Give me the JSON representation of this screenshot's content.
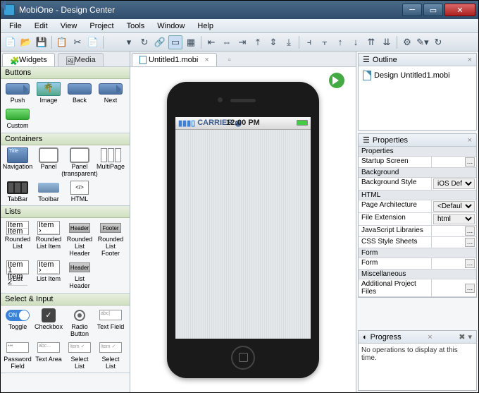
{
  "window": {
    "title": "MobiOne - Design Center"
  },
  "menu": [
    "File",
    "Edit",
    "View",
    "Project",
    "Tools",
    "Window",
    "Help"
  ],
  "left": {
    "tabs": [
      {
        "icon": "puzzle",
        "label": "Widgets",
        "active": true
      },
      {
        "icon": "media",
        "label": "Media",
        "active": false
      }
    ],
    "sections": [
      {
        "title": "Buttons",
        "items": [
          {
            "name": "push",
            "label": "Push",
            "shape": "btn-shape arrow-r"
          },
          {
            "name": "image",
            "label": "Image",
            "shape": "img-shape"
          },
          {
            "name": "back",
            "label": "Back",
            "shape": "btn-shape arrow-l"
          },
          {
            "name": "next",
            "label": "Next",
            "shape": "btn-shape arrow-r"
          },
          {
            "name": "custom",
            "label": "Custom",
            "shape": "grn-btn"
          }
        ]
      },
      {
        "title": "Containers",
        "items": [
          {
            "name": "navigation",
            "label": "Navigation",
            "shape": "nav-shape",
            "txt": "Title"
          },
          {
            "name": "panel",
            "label": "Panel",
            "shape": "panel-shape"
          },
          {
            "name": "panel-transparent",
            "label": "Panel (transparent)",
            "shape": "panel-shape"
          },
          {
            "name": "multipage",
            "label": "MultiPage",
            "shape": "multi-shape"
          },
          {
            "name": "tabbar",
            "label": "TabBar",
            "shape": "tabbar-shape"
          },
          {
            "name": "toolbar",
            "label": "Toolbar",
            "shape": "toolbar-shape"
          },
          {
            "name": "html",
            "label": "HTML",
            "shape": "html-shape",
            "txt": "</>"
          }
        ]
      },
      {
        "title": "Lists",
        "items": [
          {
            "name": "rounded-list",
            "label": "Rounded List",
            "shape": "list-shape",
            "txt": "Item|Item"
          },
          {
            "name": "rounded-list-item",
            "label": "Rounded List Item",
            "shape": "list-shape",
            "txt": "Item  ›"
          },
          {
            "name": "rounded-list-header",
            "label": "Rounded List Header",
            "shape": "hdr-shape",
            "txt": "Header"
          },
          {
            "name": "rounded-list-footer",
            "label": "Rounded List Footer",
            "shape": "hdr-shape",
            "txt": "Footer"
          },
          {
            "name": "list",
            "label": "List",
            "shape": "list-shape",
            "txt": "Item 1|Item 2"
          },
          {
            "name": "list-item",
            "label": "List Item",
            "shape": "list-shape",
            "txt": "Item  ›"
          },
          {
            "name": "list-header",
            "label": "List Header",
            "shape": "hdr-shape",
            "txt": "Header"
          }
        ]
      },
      {
        "title": "Select & Input",
        "items": [
          {
            "name": "toggle",
            "label": "Toggle",
            "shape": "toggle-on",
            "txt": "ON"
          },
          {
            "name": "checkbox",
            "label": "Checkbox",
            "shape": "chk-shape",
            "txt": "✓"
          },
          {
            "name": "radio",
            "label": "Radio Button",
            "shape": "radio-shape"
          },
          {
            "name": "text-field",
            "label": "Text Field",
            "shape": "txt-shape",
            "txt": "abc|"
          },
          {
            "name": "password",
            "label": "Password Field",
            "shape": "txt-shape",
            "txt": "•••"
          },
          {
            "name": "textarea",
            "label": "Text Area",
            "shape": "txt-shape",
            "txt": "abc..."
          },
          {
            "name": "select-list",
            "label": "Select List",
            "shape": "txt-shape",
            "txt": "Item ✓"
          },
          {
            "name": "select-list2",
            "label": "Select List",
            "shape": "txt-shape",
            "txt": "Item ✓"
          }
        ]
      }
    ]
  },
  "center": {
    "tab_label": "Untitled1.mobi",
    "status": {
      "carrier": "CARRIER",
      "time": "12:00 PM"
    }
  },
  "outline": {
    "title": "Outline",
    "item": "Design Untitled1.mobi"
  },
  "properties": {
    "title": "Properties",
    "groups": [
      {
        "header": "Properties",
        "rows": [
          {
            "k": "Startup Screen",
            "v": "",
            "btn": true
          }
        ]
      },
      {
        "header": "Background",
        "rows": [
          {
            "k": "Background Style",
            "v": "iOS Default (strip...",
            "select": true
          }
        ]
      },
      {
        "header": "HTML",
        "rows": [
          {
            "k": "Page Architecture",
            "v": "<Default>",
            "select": true
          },
          {
            "k": "File Extension",
            "v": "html",
            "select": true
          },
          {
            "k": "JavaScript Libraries",
            "v": "",
            "btn": true
          },
          {
            "k": "CSS Style Sheets",
            "v": "",
            "btn": true
          }
        ]
      },
      {
        "header": "Form",
        "rows": [
          {
            "k": "Form",
            "v": "",
            "btn": true
          }
        ]
      },
      {
        "header": "Miscellaneous",
        "rows": [
          {
            "k": "Additional Project Files",
            "v": "",
            "btn": true
          }
        ]
      }
    ]
  },
  "progress": {
    "title": "Progress",
    "msg": "No operations to display at this time."
  }
}
